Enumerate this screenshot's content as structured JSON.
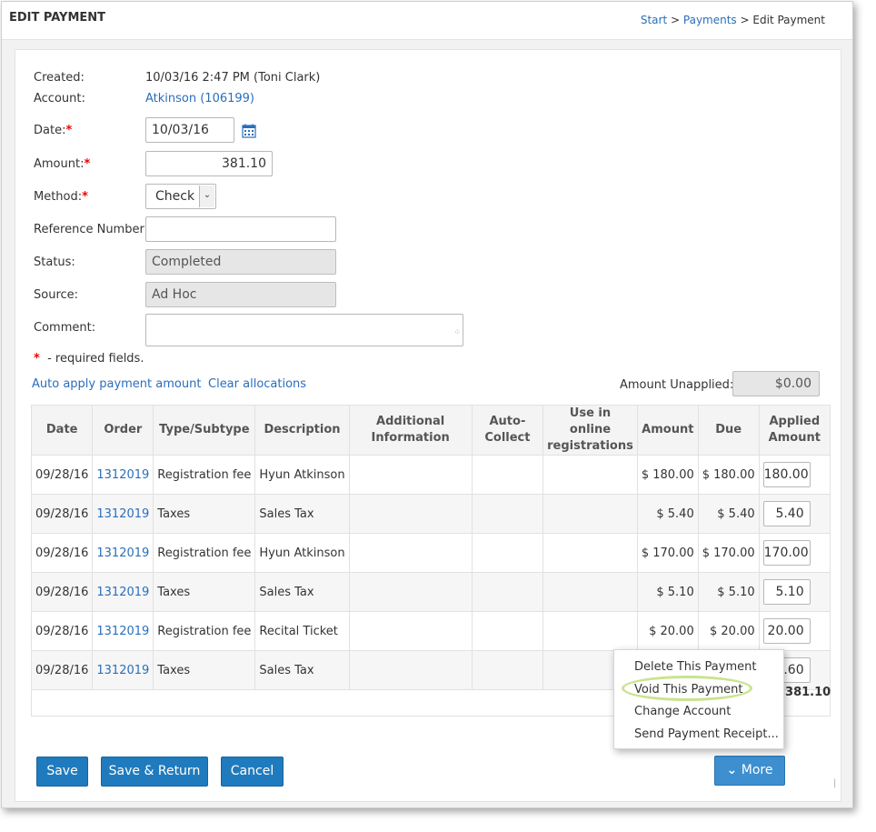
{
  "header": {
    "title": "EDIT PAYMENT",
    "breadcrumb": [
      {
        "label": "Start"
      },
      {
        "label": "Payments"
      },
      {
        "label": "Edit Payment"
      }
    ],
    "separator": ">"
  },
  "form": {
    "created_label": "Created:",
    "created_value": "10/03/16 2:47 PM (Toni Clark)",
    "account_label": "Account:",
    "account_value": "Atkinson (106199)",
    "date_label": "Date:",
    "date_value": "10/03/16",
    "amount_label": "Amount:",
    "amount_value": "381.10",
    "method_label": "Method:",
    "method_value": "Check",
    "reference_label": "Reference Number:",
    "reference_value": "",
    "status_label": "Status:",
    "status_value": "Completed",
    "source_label": "Source:",
    "source_value": "Ad Hoc",
    "comment_label": "Comment:",
    "comment_value": "",
    "required_marker": "*",
    "required_note": "- required fields."
  },
  "actions": {
    "auto_apply": "Auto apply payment amount",
    "clear_allocations": "Clear allocations",
    "amount_unapplied_label": "Amount Unapplied:",
    "amount_unapplied_value": "$0.00"
  },
  "table": {
    "headers": [
      "Date",
      "Order",
      "Type/Subtype",
      "Description",
      "Additional Information",
      "Auto-Collect",
      "Use in online registrations",
      "Amount",
      "Due",
      "Applied Amount"
    ],
    "rows": [
      {
        "date": "09/28/16",
        "order": "1312019",
        "type": "Registration fee",
        "description": "Hyun Atkinson",
        "additional": "",
        "auto": "",
        "online": "",
        "amount": "$ 180.00",
        "due": "$ 180.00",
        "applied": "180.00"
      },
      {
        "date": "09/28/16",
        "order": "1312019",
        "type": "Taxes",
        "description": "Sales Tax",
        "additional": "",
        "auto": "",
        "online": "",
        "amount": "$ 5.40",
        "due": "$ 5.40",
        "applied": "5.40"
      },
      {
        "date": "09/28/16",
        "order": "1312019",
        "type": "Registration fee",
        "description": "Hyun Atkinson",
        "additional": "",
        "auto": "",
        "online": "",
        "amount": "$ 170.00",
        "due": "$ 170.00",
        "applied": "170.00"
      },
      {
        "date": "09/28/16",
        "order": "1312019",
        "type": "Taxes",
        "description": "Sales Tax",
        "additional": "",
        "auto": "",
        "online": "",
        "amount": "$ 5.10",
        "due": "$ 5.10",
        "applied": "5.10"
      },
      {
        "date": "09/28/16",
        "order": "1312019",
        "type": "Registration fee",
        "description": "Recital Ticket",
        "additional": "",
        "auto": "",
        "online": "",
        "amount": "$ 20.00",
        "due": "$ 20.00",
        "applied": "20.00"
      },
      {
        "date": "09/28/16",
        "order": "1312019",
        "type": "Taxes",
        "description": "Sales Tax",
        "additional": "",
        "auto": "",
        "online": "",
        "amount": "",
        "due": "",
        "applied": ".60"
      }
    ],
    "total_applied": "$381.10"
  },
  "buttons": {
    "save": "Save",
    "save_return": "Save & Return",
    "cancel": "Cancel",
    "more": "More"
  },
  "more_menu": {
    "items": [
      "Delete This Payment",
      "Void This Payment",
      "Change Account",
      "Send Payment Receipt..."
    ],
    "highlighted": "Void This Payment"
  },
  "colors": {
    "link": "#2a6ebb",
    "primary_button": "#1f7bbd",
    "required": "#ee0000",
    "highlight": "#c9e48e"
  },
  "icons": {
    "date_picker": "calendar-icon",
    "more_button": "chevron-down-icon",
    "method_dropdown": "chevron-down-icon"
  }
}
